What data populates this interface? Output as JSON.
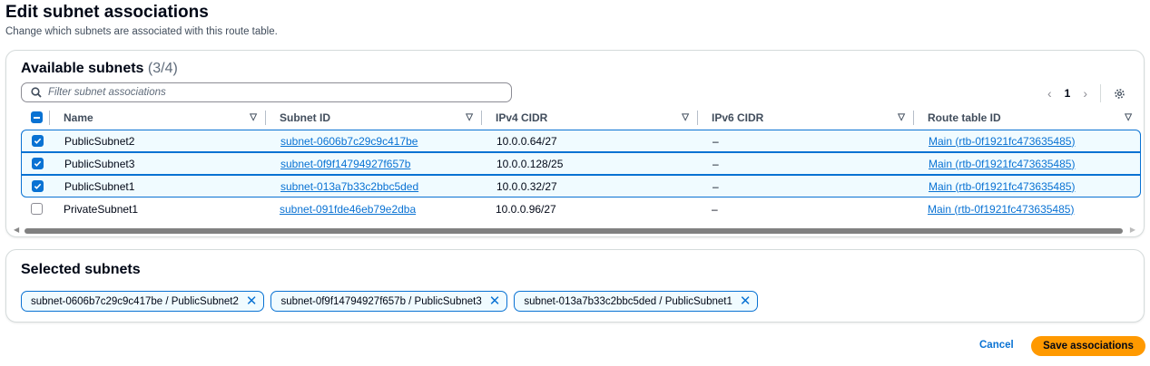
{
  "page": {
    "title": "Edit subnet associations",
    "subtitle": "Change which subnets are associated with this route table."
  },
  "available": {
    "heading": "Available subnets",
    "count": "(3/4)",
    "search_placeholder": "Filter subnet associations",
    "page": "1",
    "columns": [
      "Name",
      "Subnet ID",
      "IPv4 CIDR",
      "IPv6 CIDR",
      "Route table ID"
    ],
    "rows": [
      {
        "checked": true,
        "name": "PublicSubnet2",
        "subnet_id": "subnet-0606b7c29c9c417be",
        "ipv4": "10.0.0.64/27",
        "ipv6": "–",
        "route_table": "Main (rtb-0f1921fc473635485)"
      },
      {
        "checked": true,
        "name": "PublicSubnet3",
        "subnet_id": "subnet-0f9f14794927f657b",
        "ipv4": "10.0.0.128/25",
        "ipv6": "–",
        "route_table": "Main (rtb-0f1921fc473635485)"
      },
      {
        "checked": true,
        "name": "PublicSubnet1",
        "subnet_id": "subnet-013a7b33c2bbc5ded",
        "ipv4": "10.0.0.32/27",
        "ipv6": "–",
        "route_table": "Main (rtb-0f1921fc473635485)"
      },
      {
        "checked": false,
        "name": "PrivateSubnet1",
        "subnet_id": "subnet-091fde46eb79e2dba",
        "ipv4": "10.0.0.96/27",
        "ipv6": "–",
        "route_table": "Main (rtb-0f1921fc473635485)"
      }
    ]
  },
  "selected": {
    "heading": "Selected subnets",
    "tokens": [
      "subnet-0606b7c29c9c417be / PublicSubnet2",
      "subnet-0f9f14794927f657b / PublicSubnet3",
      "subnet-013a7b33c2bbc5ded / PublicSubnet1"
    ]
  },
  "actions": {
    "cancel": "Cancel",
    "save": "Save associations"
  },
  "colors": {
    "accent": "#0972d3",
    "primary_button": "#ff9900"
  }
}
